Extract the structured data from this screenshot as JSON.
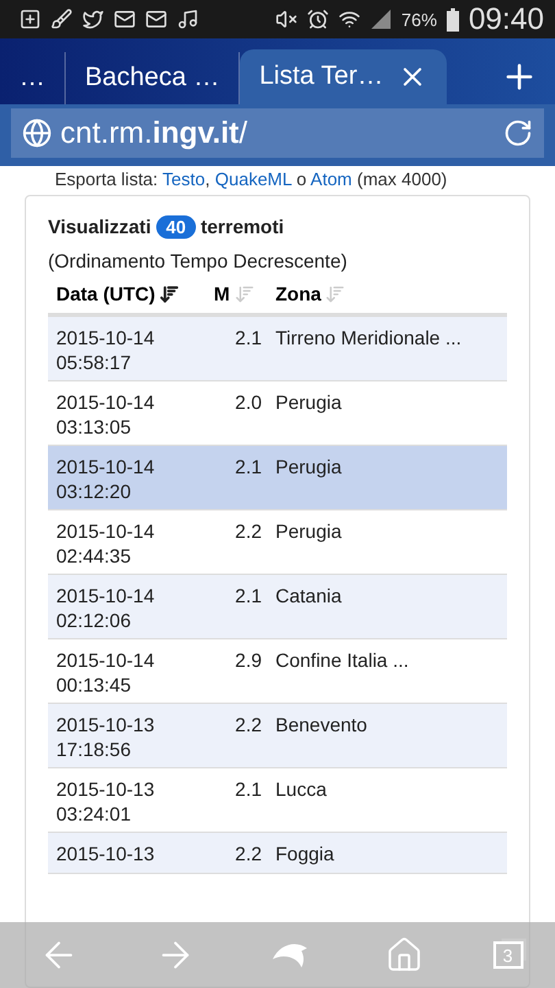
{
  "status_bar": {
    "battery": "76%",
    "time": "09:40"
  },
  "tabs": [
    {
      "title": "…",
      "selected": false
    },
    {
      "title": "Bacheca …",
      "selected": false
    },
    {
      "title": "Lista Ter…",
      "selected": true
    }
  ],
  "address_bar": {
    "url": "cnt.rm.**ingv.it**/"
  },
  "export": {
    "label": "Esporta lista:",
    "links": [
      "Testo",
      "QuakeML",
      "Atom"
    ],
    "separators": [
      ",",
      "o"
    ],
    "note": "(max 4000)"
  },
  "summary": {
    "prefix": "Visualizzati",
    "count": "40",
    "suffix": "terremoti",
    "order": "(Ordinamento Tempo Decrescente)"
  },
  "table": {
    "columns": [
      {
        "label": "Data (UTC)",
        "sorted": true
      },
      {
        "label": "M",
        "sorted": false
      },
      {
        "label": "Zona",
        "sorted": false
      }
    ],
    "rows": [
      {
        "date": "2015-10-14",
        "time": "05:58:17",
        "magnitude": "2.1",
        "zone": "Tirreno Meridionale ...",
        "selected": false
      },
      {
        "date": "2015-10-14",
        "time": "03:13:05",
        "magnitude": "2.0",
        "zone": "Perugia",
        "selected": false
      },
      {
        "date": "2015-10-14",
        "time": "03:12:20",
        "magnitude": "2.1",
        "zone": "Perugia",
        "selected": true
      },
      {
        "date": "2015-10-14",
        "time": "02:44:35",
        "magnitude": "2.2",
        "zone": "Perugia",
        "selected": false
      },
      {
        "date": "2015-10-14",
        "time": "02:12:06",
        "magnitude": "2.1",
        "zone": "Catania",
        "selected": false
      },
      {
        "date": "2015-10-14",
        "time": "00:13:45",
        "magnitude": "2.9",
        "zone": "Confine Italia ...",
        "selected": false
      },
      {
        "date": "2015-10-13",
        "time": "17:18:56",
        "magnitude": "2.2",
        "zone": "Benevento",
        "selected": false
      },
      {
        "date": "2015-10-13",
        "time": "03:24:01",
        "magnitude": "2.1",
        "zone": "Lucca",
        "selected": false
      },
      {
        "date": "2015-10-13",
        "magnitude": "2.2",
        "zone": "Foggia",
        "selected": false
      }
    ]
  },
  "toolbar": {
    "tab_count": "3"
  }
}
